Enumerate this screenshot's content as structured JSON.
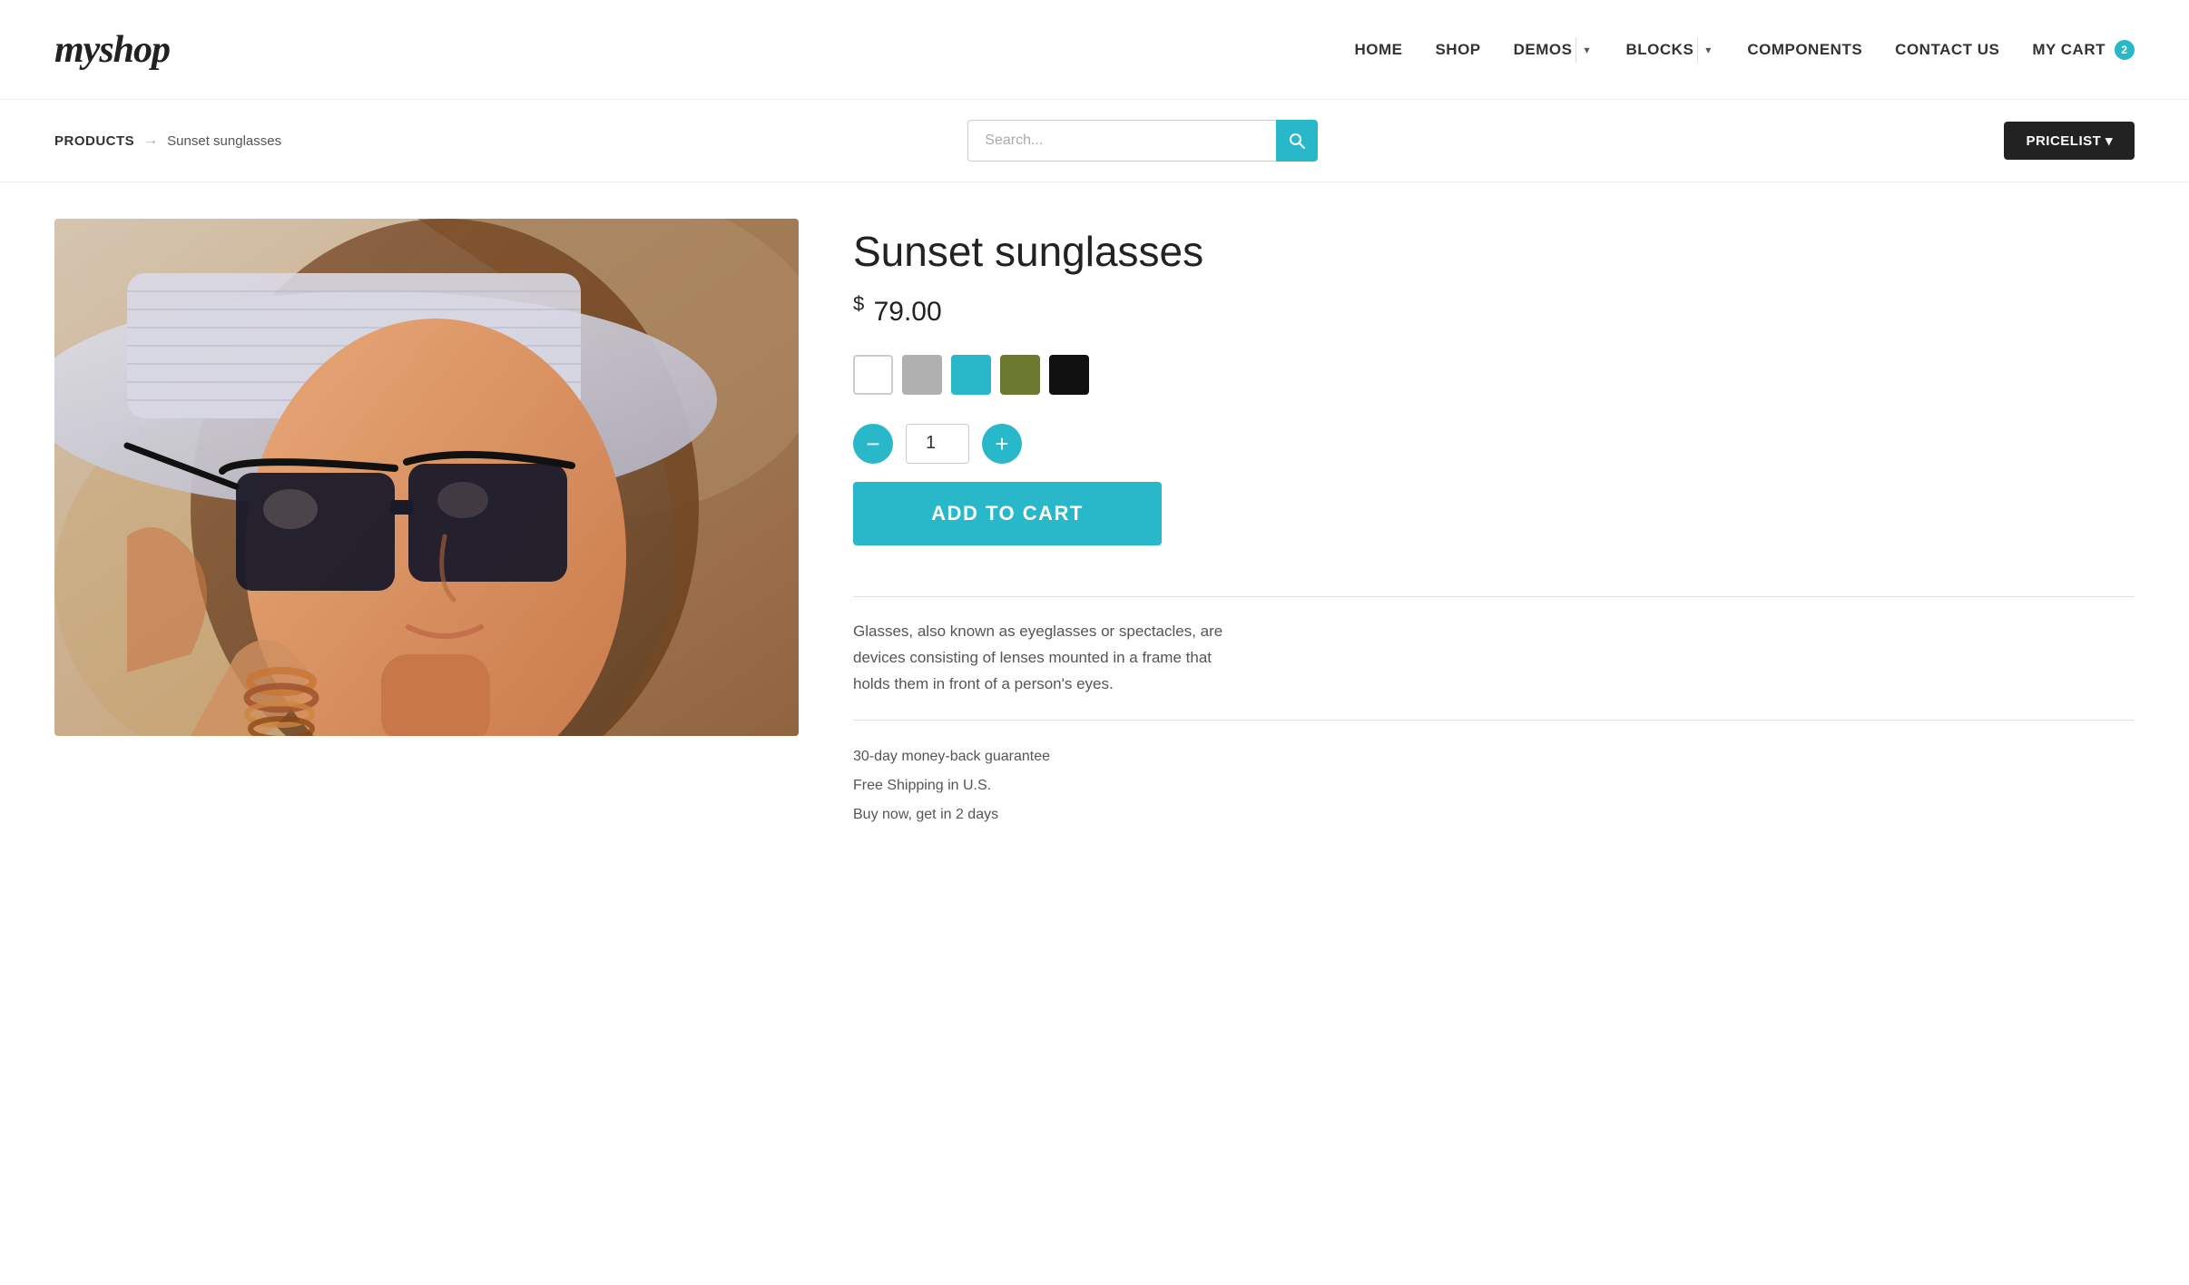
{
  "logo": {
    "text_my": "my",
    "text_shop": "shop"
  },
  "nav": {
    "items": [
      {
        "label": "HOME",
        "has_dropdown": false
      },
      {
        "label": "SHOP",
        "has_dropdown": false
      },
      {
        "label": "DEMOS",
        "has_dropdown": true
      },
      {
        "label": "BLOCKS",
        "has_dropdown": true
      },
      {
        "label": "COMPONENTS",
        "has_dropdown": false
      },
      {
        "label": "CONTACT US",
        "has_dropdown": false
      }
    ],
    "cart_label": "MY CART",
    "cart_count": "2"
  },
  "breadcrumb": {
    "products_label": "PRODUCTS",
    "arrow": "→",
    "current": "Sunset sunglasses"
  },
  "search": {
    "placeholder": "Search...",
    "button_icon": "🔍"
  },
  "pricelist": {
    "label": "PRICELIST ▾"
  },
  "product": {
    "title": "Sunset sunglasses",
    "price_symbol": "$",
    "price": "79.00",
    "colors": [
      {
        "name": "white",
        "class": "white"
      },
      {
        "name": "gray",
        "class": "gray"
      },
      {
        "name": "teal",
        "class": "teal"
      },
      {
        "name": "olive",
        "class": "olive"
      },
      {
        "name": "black",
        "class": "black"
      }
    ],
    "quantity": "1",
    "add_to_cart": "ADD TO CART",
    "description": "Glasses, also known as eyeglasses or spectacles, are devices consisting of lenses mounted in a frame that holds them in front of a person's eyes.",
    "features": [
      "30-day money-back guarantee",
      "Free Shipping in U.S.",
      "Buy now, get in 2 days"
    ]
  }
}
